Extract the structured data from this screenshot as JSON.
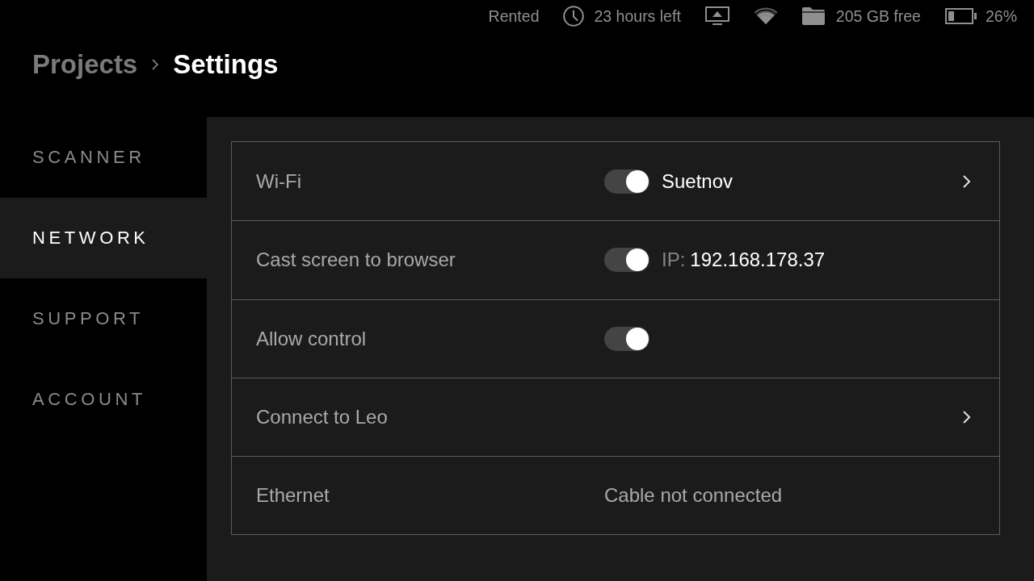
{
  "status_bar": {
    "rental": "Rented",
    "time_left": "23 hours left",
    "storage": "205 GB free",
    "battery": "26%"
  },
  "breadcrumb": [
    {
      "label": "Projects",
      "current": false
    },
    {
      "label": "Settings",
      "current": true
    }
  ],
  "sidebar": {
    "items": [
      {
        "label": "SCANNER",
        "selected": false
      },
      {
        "label": "NETWORK",
        "selected": true
      },
      {
        "label": "SUPPORT",
        "selected": false
      },
      {
        "label": "ACCOUNT",
        "selected": false
      }
    ]
  },
  "settings": {
    "rows": [
      {
        "label": "Wi-Fi",
        "switch": {
          "on": true
        },
        "value": "Suetnov",
        "chevron": true
      },
      {
        "label": "Cast screen to browser",
        "switch": {
          "on": true
        },
        "value_label": "IP:",
        "value": "192.168.178.37"
      },
      {
        "label": "Allow control",
        "switch": {
          "on": true
        }
      },
      {
        "label": "Connect to Leo",
        "chevron": true
      },
      {
        "label": "Ethernet",
        "value": "Cable not connected"
      }
    ]
  }
}
